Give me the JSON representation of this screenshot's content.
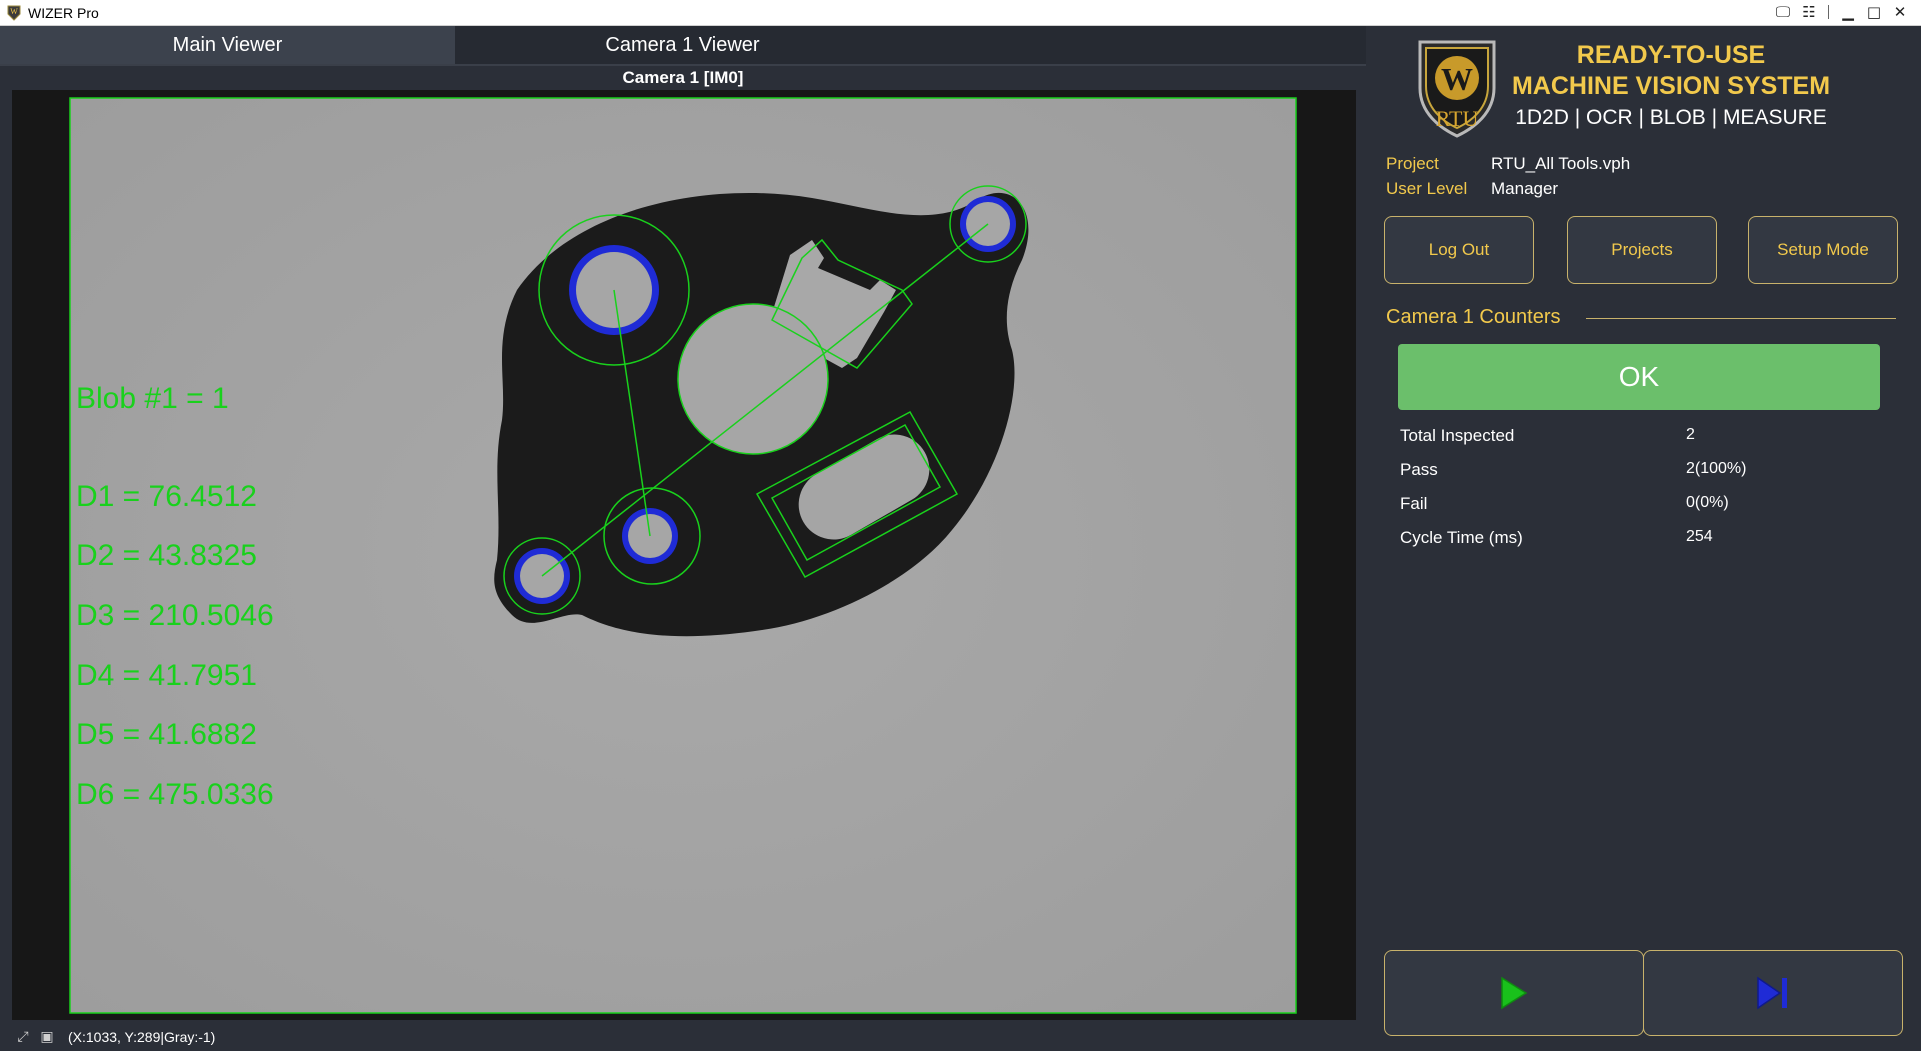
{
  "window": {
    "title": "WIZER Pro"
  },
  "tabs": [
    {
      "label": "Main Viewer"
    },
    {
      "label": "Camera 1 Viewer"
    }
  ],
  "viewer": {
    "title": "Camera 1  [IM0]",
    "overlay": [
      "Blob #1 = 1",
      "D1 = 76.4512",
      "D2 = 43.8325",
      "D3 = 210.5046",
      "D4 = 41.7951",
      "D5 = 41.6882",
      "D6 = 475.0336"
    ]
  },
  "statusbar": {
    "coordinates": "(X:1033, Y:289|Gray:-1)"
  },
  "brand": {
    "logo_text": "RTU",
    "logo_letter": "W",
    "line1": "READY-TO-USE",
    "line2": "MACHINE VISION SYSTEM",
    "tools": "1D2D | OCR | BLOB | MEASURE"
  },
  "info": {
    "project_label": "Project",
    "project_value": "RTU_All Tools.vph",
    "user_level_label": "User Level",
    "user_level_value": "Manager"
  },
  "buttons": {
    "logout": "Log Out",
    "projects": "Projects",
    "setup": "Setup Mode"
  },
  "counters": {
    "title": "Camera 1 Counters",
    "status": "OK",
    "rows": [
      {
        "label": "Total Inspected",
        "value": "2"
      },
      {
        "label": "Pass",
        "value": "2(100%)"
      },
      {
        "label": "Fail",
        "value": "0(0%)"
      },
      {
        "label": "Cycle Time (ms)",
        "value": "254"
      }
    ]
  },
  "colors": {
    "accent": "#f2c94c",
    "ok": "#6bbf6b",
    "overlay": "#19d11c",
    "blob": "#1f2bd6"
  },
  "icons": {
    "run": "play-icon",
    "step": "step-forward-icon"
  }
}
